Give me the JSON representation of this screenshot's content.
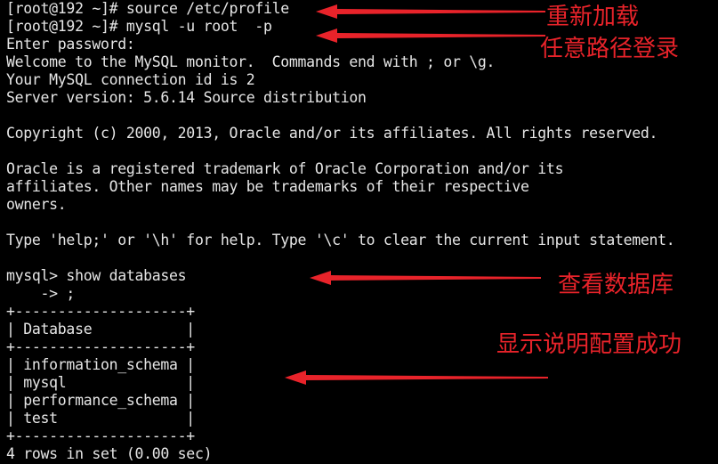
{
  "terminal": {
    "lines": [
      "[root@192 ~]# source /etc/profile",
      "[root@192 ~]# mysql -u root  -p",
      "Enter password:",
      "Welcome to the MySQL monitor.  Commands end with ; or \\g.",
      "Your MySQL connection id is 2",
      "Server version: 5.6.14 Source distribution",
      "",
      "Copyright (c) 2000, 2013, Oracle and/or its affiliates. All rights reserved.",
      "",
      "Oracle is a registered trademark of Oracle Corporation and/or its",
      "affiliates. Other names may be trademarks of their respective",
      "owners.",
      "",
      "Type 'help;' or '\\h' for help. Type '\\c' to clear the current input statement.",
      "",
      "mysql> show databases",
      "    -> ;",
      "+--------------------+",
      "| Database           |",
      "+--------------------+",
      "| information_schema |",
      "| mysql              |",
      "| performance_schema |",
      "| test               |",
      "+--------------------+",
      "4 rows in set (0.00 sec)"
    ]
  },
  "annotations": {
    "reload": "重新加载",
    "login_any_path": "任意路径登录",
    "view_databases": "查看数据库",
    "config_success": "显示说明配置成功"
  },
  "colors": {
    "background": "#000000",
    "terminal_text": "#e6e6e6",
    "annotation": "#e8232a"
  }
}
